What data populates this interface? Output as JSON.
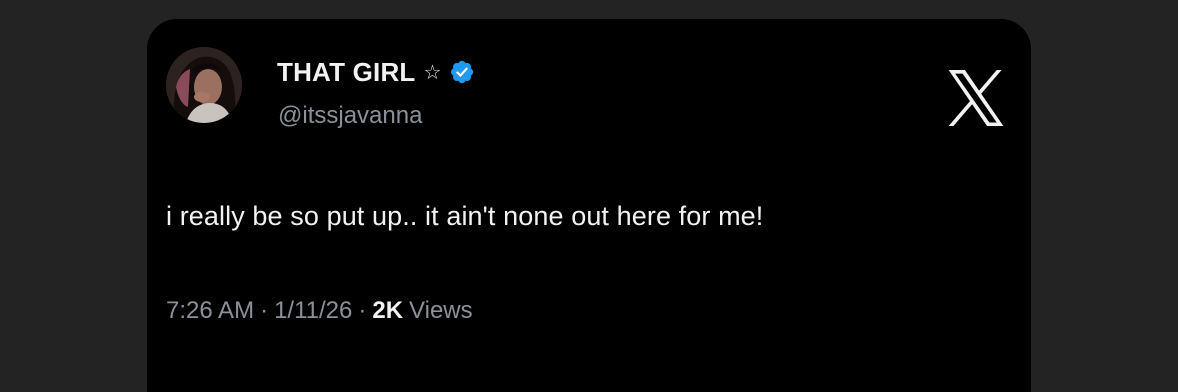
{
  "tweet": {
    "display_name": "THAT GIRL",
    "star_icon": "☆",
    "verified_icon": "verified-badge-icon",
    "verified_color": "#1d9bf0",
    "handle": "@itssjavanna",
    "text": "i really be so put up.. it ain't none out here for me!",
    "time": "7:26 AM",
    "separator": "·",
    "date": "1/11/26",
    "views_count": "2K",
    "views_label": "Views",
    "brand_icon": "x-logo-icon"
  }
}
